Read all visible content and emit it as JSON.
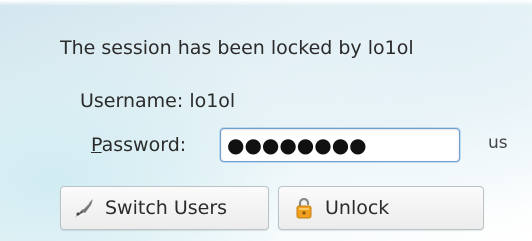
{
  "dialog": {
    "header": "The session has been locked by lo1ol",
    "username_label": "Username:",
    "username_value": "lo1ol",
    "password_label_mnemonic": "P",
    "password_label_rest": "assword:",
    "password_masked": "●●●●●●●●",
    "keyboard_layout": "us"
  },
  "buttons": {
    "switch_users": {
      "label": "Switch Users",
      "icon": "switch-users-icon"
    },
    "unlock": {
      "label": "Unlock",
      "icon": "padlock-icon"
    }
  },
  "colors": {
    "input_focus_border": "#6d9fd0",
    "padlock": "#f0a020",
    "switch_icon": "#555555"
  }
}
